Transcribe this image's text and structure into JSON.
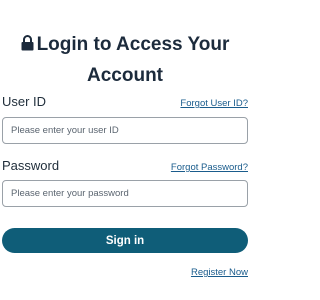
{
  "header": {
    "title": "Login to Access Your Account",
    "icon": "lock-icon"
  },
  "user_id": {
    "label": "User ID",
    "forgot_link": "Forgot User ID?",
    "placeholder": "Please enter your user ID",
    "value": ""
  },
  "password": {
    "label": "Password",
    "forgot_link": "Forgot Password?",
    "placeholder": "Please enter your password",
    "value": ""
  },
  "actions": {
    "signin_label": "Sign in",
    "register_link": "Register Now"
  },
  "colors": {
    "primary": "#0f5d78",
    "link": "#1a5c8c",
    "heading": "#1c2b3c"
  }
}
